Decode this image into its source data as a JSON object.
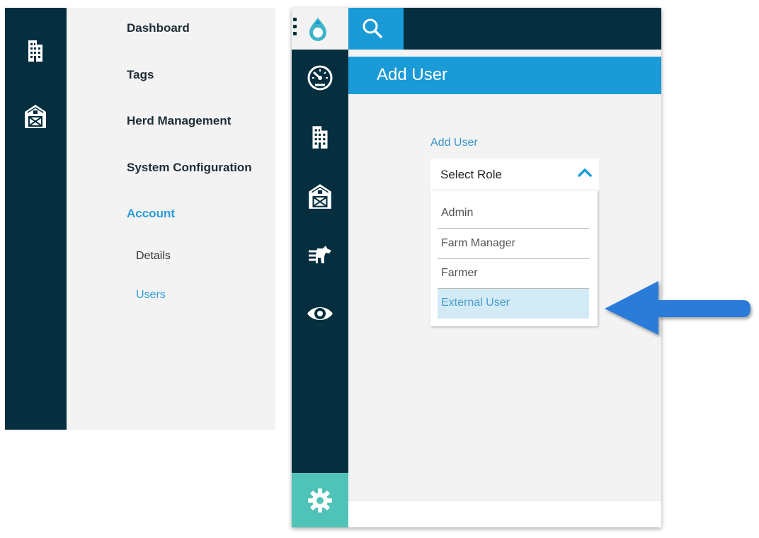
{
  "left_nav": {
    "items": [
      {
        "label": "Dashboard"
      },
      {
        "label": "Tags"
      },
      {
        "label": "Herd Management"
      },
      {
        "label": "System Configuration"
      },
      {
        "label": "Account"
      }
    ],
    "sub_items": [
      {
        "label": "Details"
      },
      {
        "label": "Users"
      }
    ],
    "active_item": "Account",
    "active_sub_item": "Users"
  },
  "left_rail": {
    "icons": [
      "building-icon",
      "barn-icon"
    ]
  },
  "app": {
    "side_rail_icons": [
      "dashboard-gauge-icon",
      "building-icon",
      "barn-icon",
      "cow-transfer-icon",
      "eye-icon",
      "gear-icon"
    ],
    "page_title": "Add User",
    "form_label": "Add User",
    "role_select": {
      "value": "Select Role",
      "expanded": true,
      "options": [
        "Admin",
        "Farm Manager",
        "Farmer",
        "External User"
      ],
      "highlighted_option": "External User"
    }
  },
  "colors": {
    "dark_navy": "#052e3f",
    "accent_blue": "#1a9ad6",
    "teal": "#4fc3b8",
    "link_blue": "#2a9bd8",
    "highlight_bg": "#d2ebf6",
    "panel_bg": "#f3f3f3",
    "callout_arrow": "#2c7bd8"
  }
}
